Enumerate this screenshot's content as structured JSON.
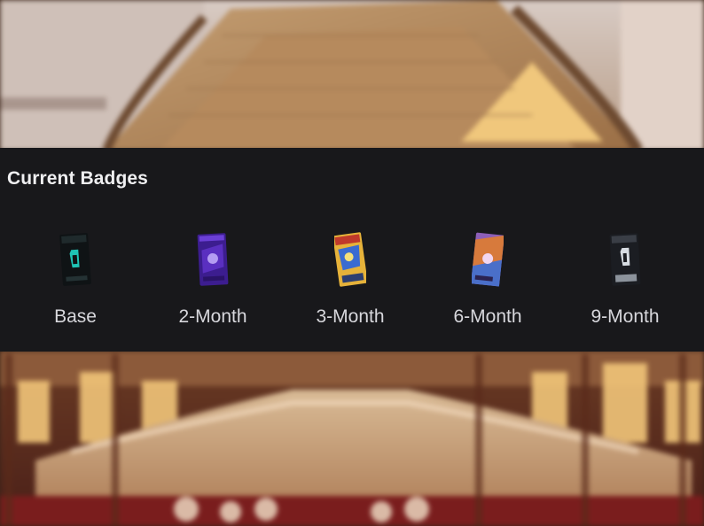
{
  "panel": {
    "title": "Current Badges"
  },
  "badges": [
    {
      "label": "Base",
      "icon": "base-badge-icon"
    },
    {
      "label": "2-Month",
      "icon": "2-month-badge-icon"
    },
    {
      "label": "3-Month",
      "icon": "3-month-badge-icon"
    },
    {
      "label": "6-Month",
      "icon": "6-month-badge-icon"
    },
    {
      "label": "9-Month",
      "icon": "9-month-badge-icon"
    }
  ],
  "colors": {
    "panel_background": "#18181b",
    "title_text": "#efeff1",
    "label_text": "#d7d7dc"
  }
}
